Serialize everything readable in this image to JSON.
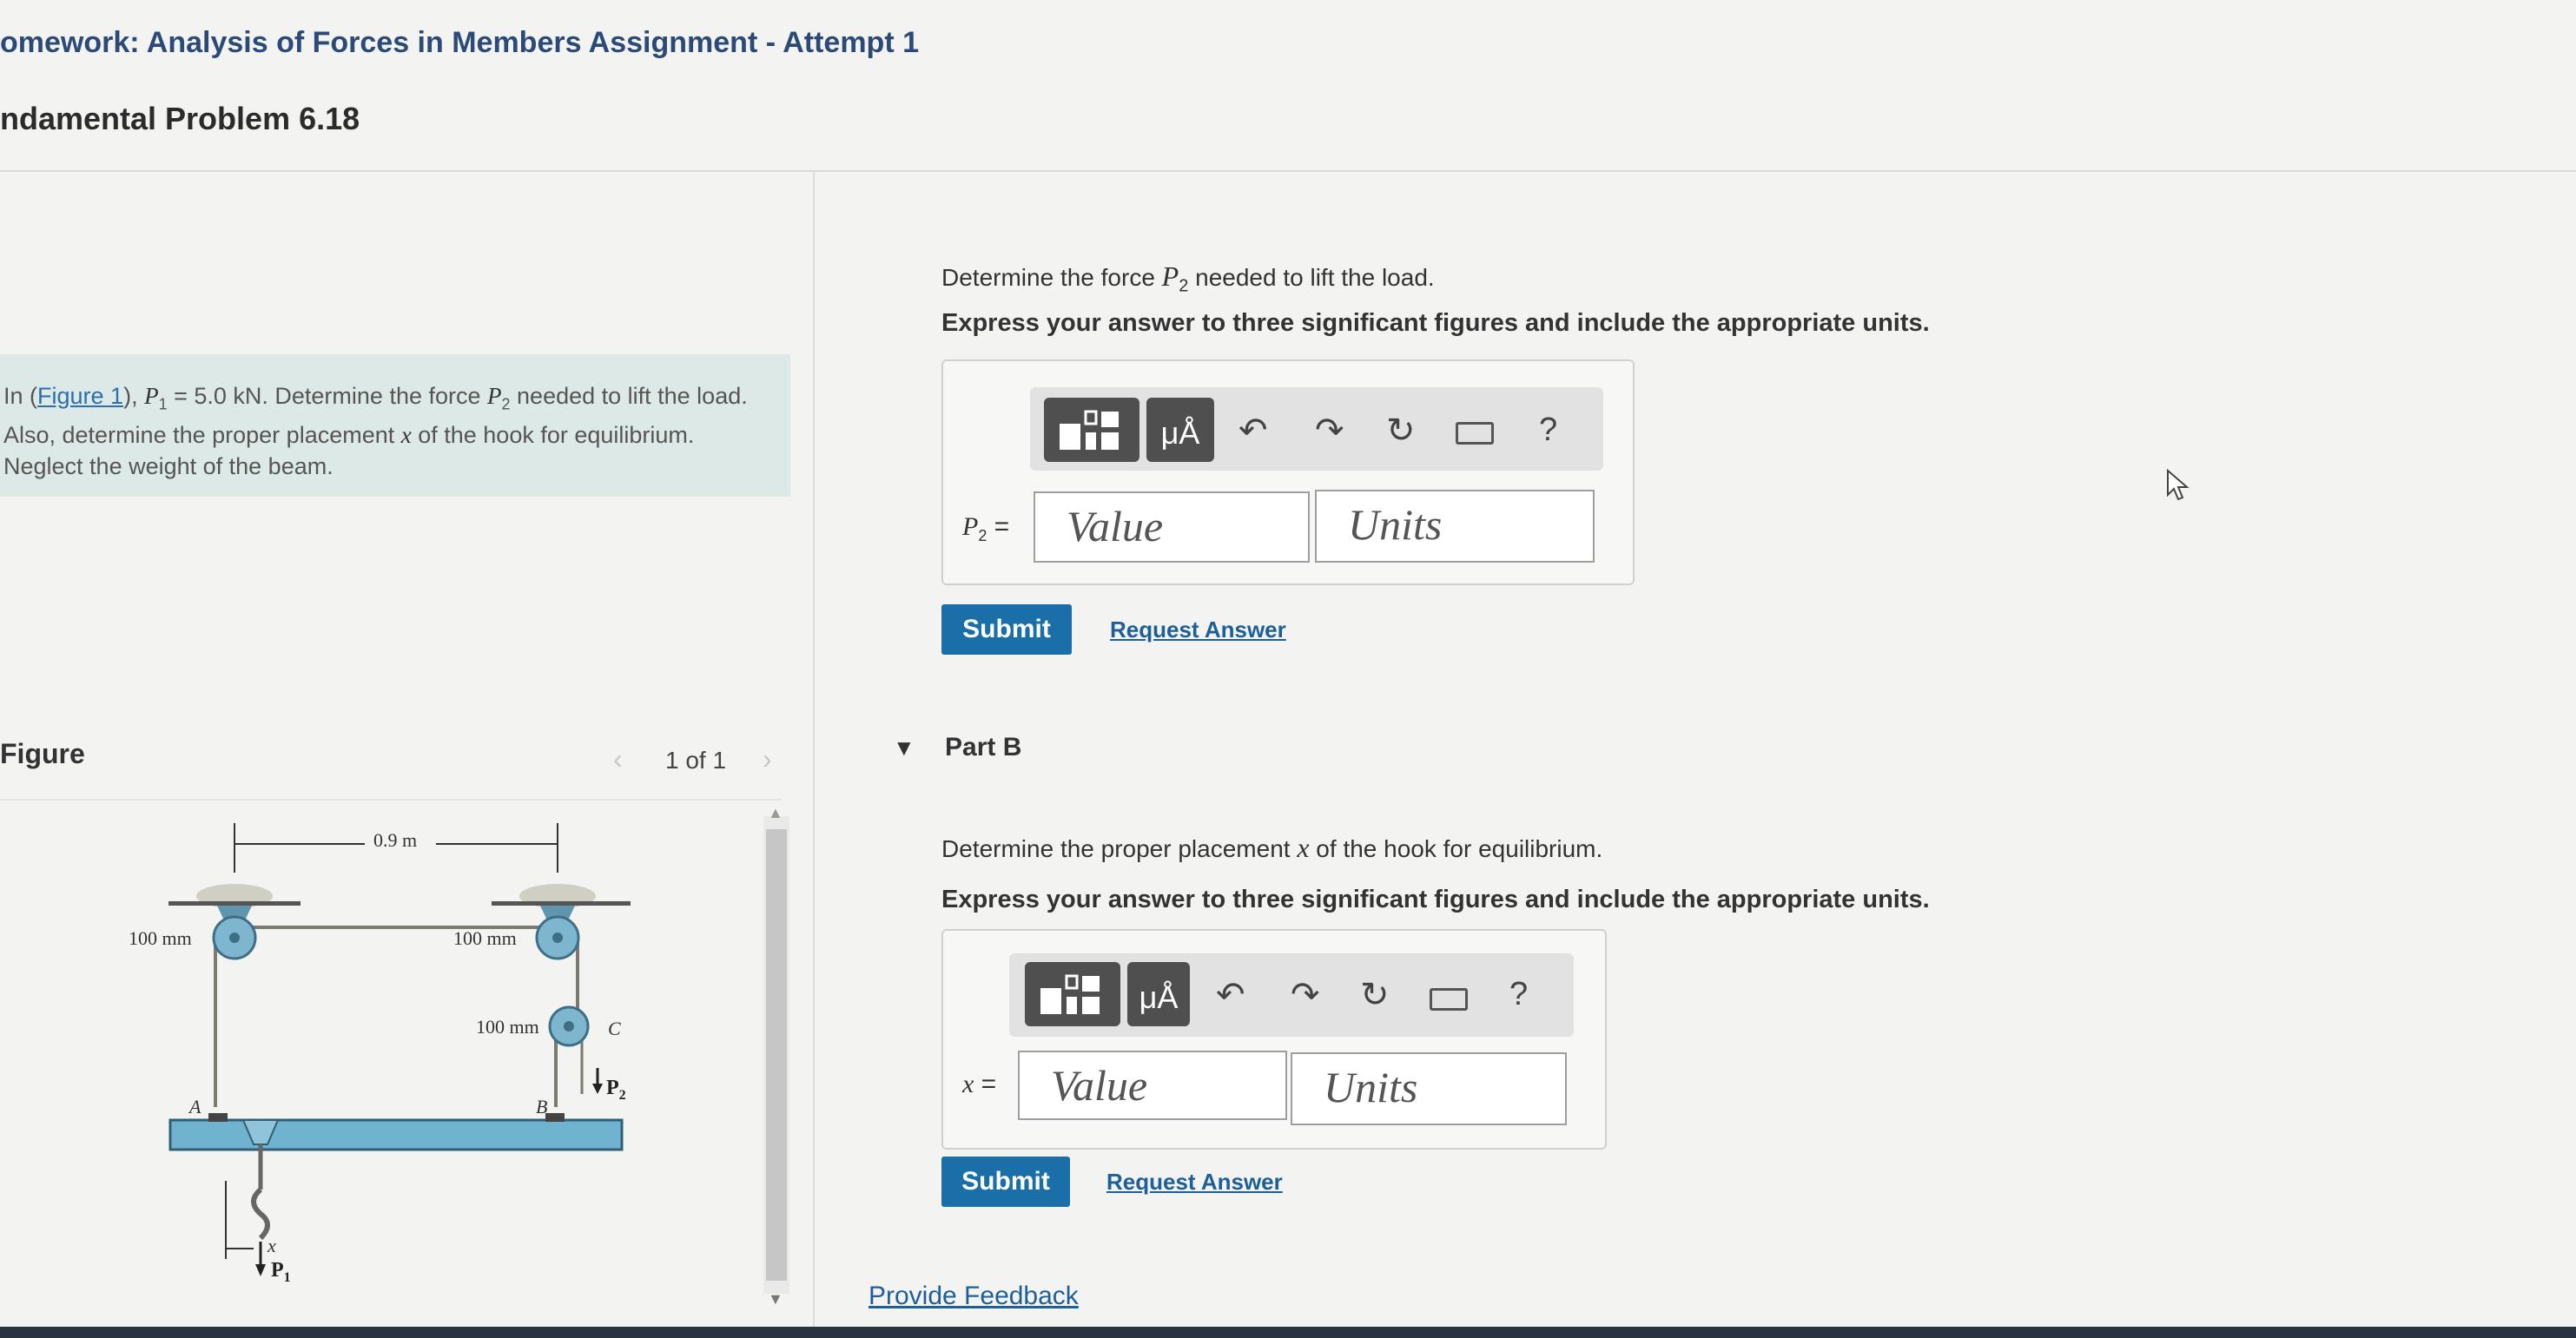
{
  "header": {
    "assignment_title": "omework: Analysis of Forces in Members Assignment - Attempt 1",
    "problem_title": "ndamental Problem 6.18"
  },
  "problem": {
    "text_in": "In (",
    "figure_link": "Figure 1",
    "text_after_link": "), ",
    "p1_symbol": "P",
    "p1_sub": "1",
    "p1_value": " = 5.0 kN. Determine the force ",
    "p2_symbol": "P",
    "p2_sub": "2",
    "text_rest": " needed to lift the load. Also, determine the proper placement ",
    "x_symbol": "x",
    "text_end": " of the hook for equilibrium. Neglect the weight of the beam."
  },
  "figure": {
    "label": "Figure",
    "pager": "1 of 1",
    "prev_icon": "chevron-left-icon",
    "next_icon": "chevron-right-icon",
    "dimension_top": "0.9 m",
    "dim_left_pulley": "100 mm",
    "dim_right_pulley": "100 mm",
    "dim_pulley_c": "100 mm",
    "point_a": "A",
    "point_b": "B",
    "point_c": "C",
    "x_label": "x",
    "p1_label": "P",
    "p1_sub": "1",
    "p2_label": "P",
    "p2_sub": "2"
  },
  "part_a": {
    "question_pre": "Determine the force ",
    "question_symbol": "P",
    "question_sub": "2",
    "question_post": " needed to lift the load.",
    "instruction": "Express your answer to three significant figures and include the appropriate units.",
    "answer_label_symbol": "P",
    "answer_label_sub": "2",
    "answer_label_eq": " =",
    "value_placeholder": "Value",
    "units_placeholder": "Units",
    "submit_label": "Submit",
    "request_label": "Request Answer"
  },
  "part_b": {
    "title": "Part B",
    "question_pre": "Determine the proper placement ",
    "question_symbol": "x",
    "question_post": " of the hook for equilibrium.",
    "instruction": "Express your answer to three significant figures and include the appropriate units.",
    "answer_label_symbol": "x",
    "answer_label_eq": " =",
    "value_placeholder": "Value",
    "units_placeholder": "Units",
    "submit_label": "Submit",
    "request_label": "Request Answer"
  },
  "toolbar": {
    "templates_icon": "templates-icon",
    "units_button": "μÅ",
    "undo_icon": "undo-icon",
    "redo_icon": "redo-icon",
    "reset_icon": "reset-icon",
    "keyboard_icon": "keyboard-icon",
    "help": "?"
  },
  "footer": {
    "feedback_label": "Provide Feedback"
  },
  "colors": {
    "title_blue": "#2c4a78",
    "problem_box": "#dde9e6",
    "submit_blue": "#1a6fa8",
    "link_blue": "#1d5f99",
    "beam_blue": "#6fb3cf"
  }
}
